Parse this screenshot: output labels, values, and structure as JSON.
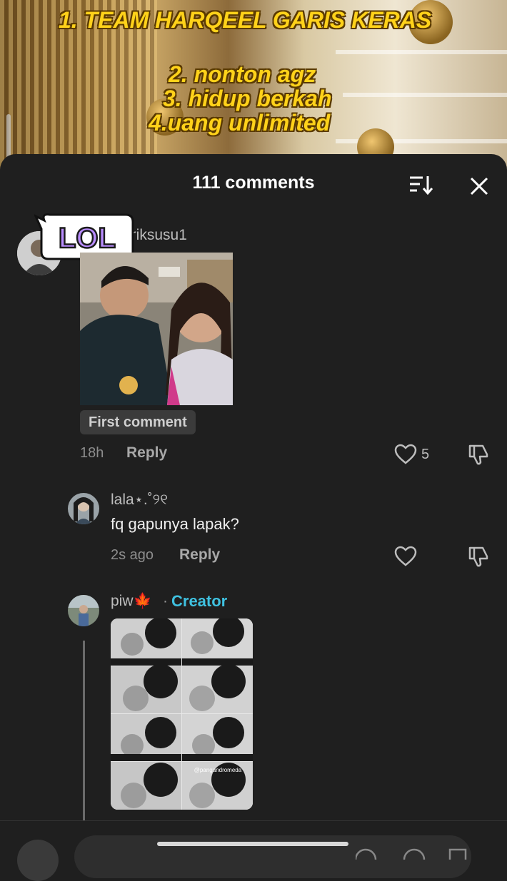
{
  "video": {
    "caption_lines": [
      "1. TEAM HARQEEL GARIS KERAS",
      "2. nonton agz",
      "3. hidup berkah",
      "4.uang unlimited"
    ]
  },
  "sheet": {
    "title": "111 comments"
  },
  "comments": [
    {
      "username": "ariksusu1",
      "sticker_text": "LOL",
      "badge": "First comment",
      "time": "18h",
      "reply_label": "Reply",
      "likes": "5"
    },
    {
      "username": "lala⋆.˚୨୧",
      "text": "fq gapunya lapak?",
      "time": "2s ago",
      "reply_label": "Reply"
    },
    {
      "username": "piw🍁",
      "separator": "·",
      "creator_label": "Creator",
      "photo_watermark": "@pangandromeda"
    }
  ],
  "colors": {
    "background": "#1f1f1f",
    "creator_accent": "#3fc1e0",
    "caption_yellow": "#ffd21a"
  }
}
